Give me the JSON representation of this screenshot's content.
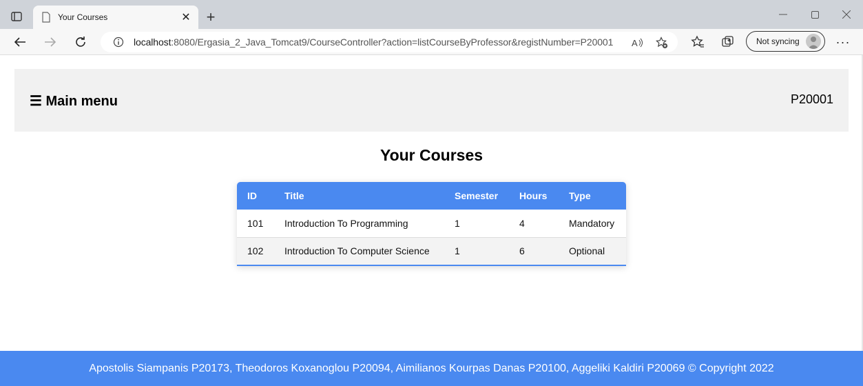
{
  "browser": {
    "tab_title": "Your Courses",
    "url_host": "localhost",
    "url_rest": ":8080/Ergasia_2_Java_Tomcat9/CourseController?action=listCourseByProfessor&registNumber=P20001",
    "sync_label": "Not syncing"
  },
  "page": {
    "menu_label": "☰ Main menu",
    "user_id": "P20001",
    "heading": "Your Courses"
  },
  "table": {
    "headers": [
      "ID",
      "Title",
      "Semester",
      "Hours",
      "Type"
    ],
    "rows": [
      [
        "101",
        "Introduction To Programming",
        "1",
        "4",
        "Mandatory"
      ],
      [
        "102",
        "Introduction To Computer Science",
        "1",
        "6",
        "Optional"
      ]
    ]
  },
  "footer": {
    "text": "Apostolis Siampanis P20173, Theodoros Koxanoglou P20094, Aimilianos Kourpas Danas P20100, Aggeliki Kaldiri P20069 © Copyright 2022"
  },
  "colors": {
    "accent": "#4a89f0",
    "header_bg": "#f1f1f1"
  }
}
